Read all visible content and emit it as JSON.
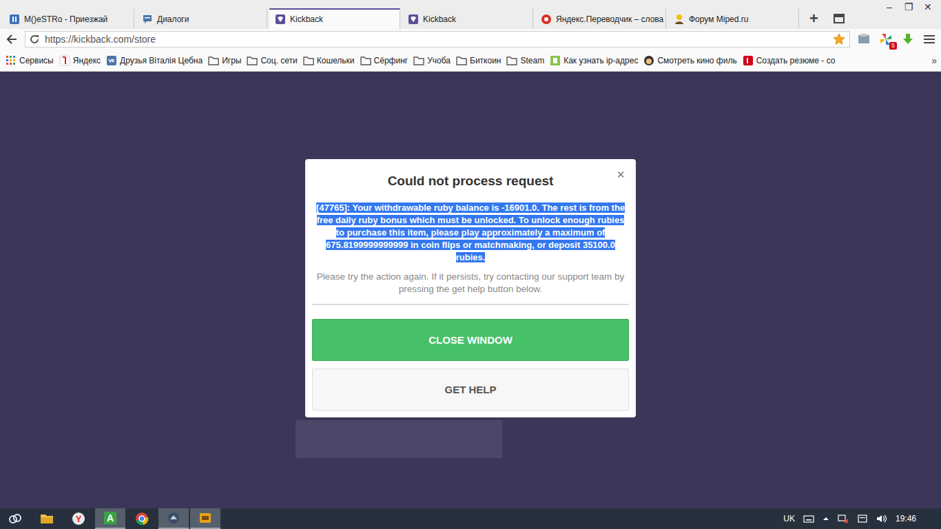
{
  "browser": {
    "tabs": [
      {
        "label": "M()eSTRo - Приезжай",
        "selected": false,
        "kind": "media"
      },
      {
        "label": "Диалоги",
        "selected": false,
        "kind": "chat"
      },
      {
        "label": "Kickback",
        "selected": true,
        "kind": "kickback"
      },
      {
        "label": "Kickback",
        "selected": false,
        "kind": "kickback"
      },
      {
        "label": "Яндекс.Переводчик – слова",
        "selected": false,
        "kind": "translate"
      },
      {
        "label": "Форум Miped.ru",
        "selected": false,
        "kind": "forum"
      }
    ],
    "new_tab": "+",
    "window_controls": [
      "–",
      "❐",
      "✕"
    ],
    "address": "https://kickback.com/store",
    "bookmarked": true,
    "extension_badge": "5",
    "bookmarks": [
      {
        "label": "Сервисы",
        "kind": "apps"
      },
      {
        "label": "Яндекс",
        "kind": "yandex"
      },
      {
        "label": "Друзья Віталія Цебна",
        "kind": "vk"
      },
      {
        "label": "Игры",
        "kind": "folder"
      },
      {
        "label": "Соц. сети",
        "kind": "folder"
      },
      {
        "label": "Кошельки",
        "kind": "folder"
      },
      {
        "label": "Сёрфинг",
        "kind": "folder"
      },
      {
        "label": "Учоба",
        "kind": "folder"
      },
      {
        "label": "Биткоин",
        "kind": "folder"
      },
      {
        "label": "Steam",
        "kind": "folder"
      },
      {
        "label": "Как узнать ip-адрес",
        "kind": "green"
      },
      {
        "label": "Смотреть кино филь",
        "kind": "face"
      },
      {
        "label": "Создать резюме - со",
        "kind": "red"
      }
    ],
    "bookmarks_more": "»"
  },
  "dialog": {
    "title": "Could not process request",
    "close": "×",
    "message": {
      "text": "[47765]: Your withdrawable ruby balance is -16901.0. The rest is from the free daily ruby bonus which must be unlocked. To unlock enough rubies to purchase this item, please play approximately a maximum of 675.8199999999999 in coin flips or matchmaking, or deposit 35100.0 rubies.",
      "selected": true
    },
    "note": "Please try the action again. If it persists, try contacting our support team by pressing the get help button below.",
    "buttons": [
      {
        "label": "CLOSE WINDOW",
        "kind": "primary"
      },
      {
        "label": "GET HELP",
        "kind": "secondary"
      }
    ]
  },
  "taskbar": {
    "apps": [
      {
        "kind": "sync",
        "active": false
      },
      {
        "kind": "folder",
        "active": false
      },
      {
        "kind": "yandex",
        "label": "Y",
        "active": false
      },
      {
        "kind": "letter",
        "label": "A",
        "active": true
      },
      {
        "kind": "chrome",
        "active": false
      },
      {
        "kind": "game",
        "active": true
      },
      {
        "kind": "app",
        "active": true
      }
    ],
    "language": "UK",
    "time": "19:46"
  }
}
